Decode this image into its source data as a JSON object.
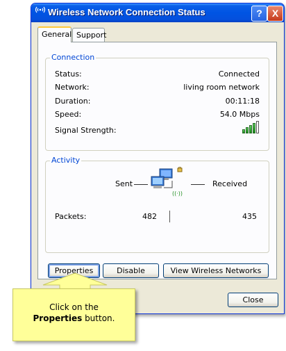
{
  "window": {
    "title": "Wireless Network Connection Status",
    "help_label": "?",
    "close_label": "X"
  },
  "tabs": {
    "general": "General",
    "support": "Support"
  },
  "connection": {
    "group_label": "Connection",
    "status_label": "Status:",
    "status_value": "Connected",
    "network_label": "Network:",
    "network_value": "living room network",
    "duration_label": "Duration:",
    "duration_value": "00:11:18",
    "speed_label": "Speed:",
    "speed_value": "54.0 Mbps",
    "signal_label": "Signal Strength:",
    "signal_bars_filled": 4,
    "signal_bars_total": 5
  },
  "activity": {
    "group_label": "Activity",
    "sent_label": "Sent",
    "received_label": "Received",
    "packets_label": "Packets:",
    "packets_sent": "482",
    "packets_received": "435"
  },
  "buttons": {
    "properties": "Properties",
    "disable": "Disable",
    "view_networks": "View Wireless Networks",
    "close": "Close"
  },
  "callout": {
    "line1": "Click on the",
    "bold": "Properties",
    "line2_rest": " button."
  },
  "colors": {
    "titlebar": "#0054e3",
    "group_label": "#0046d5",
    "callout_bg": "#ffff99",
    "dialog_bg": "#ece9d8"
  }
}
